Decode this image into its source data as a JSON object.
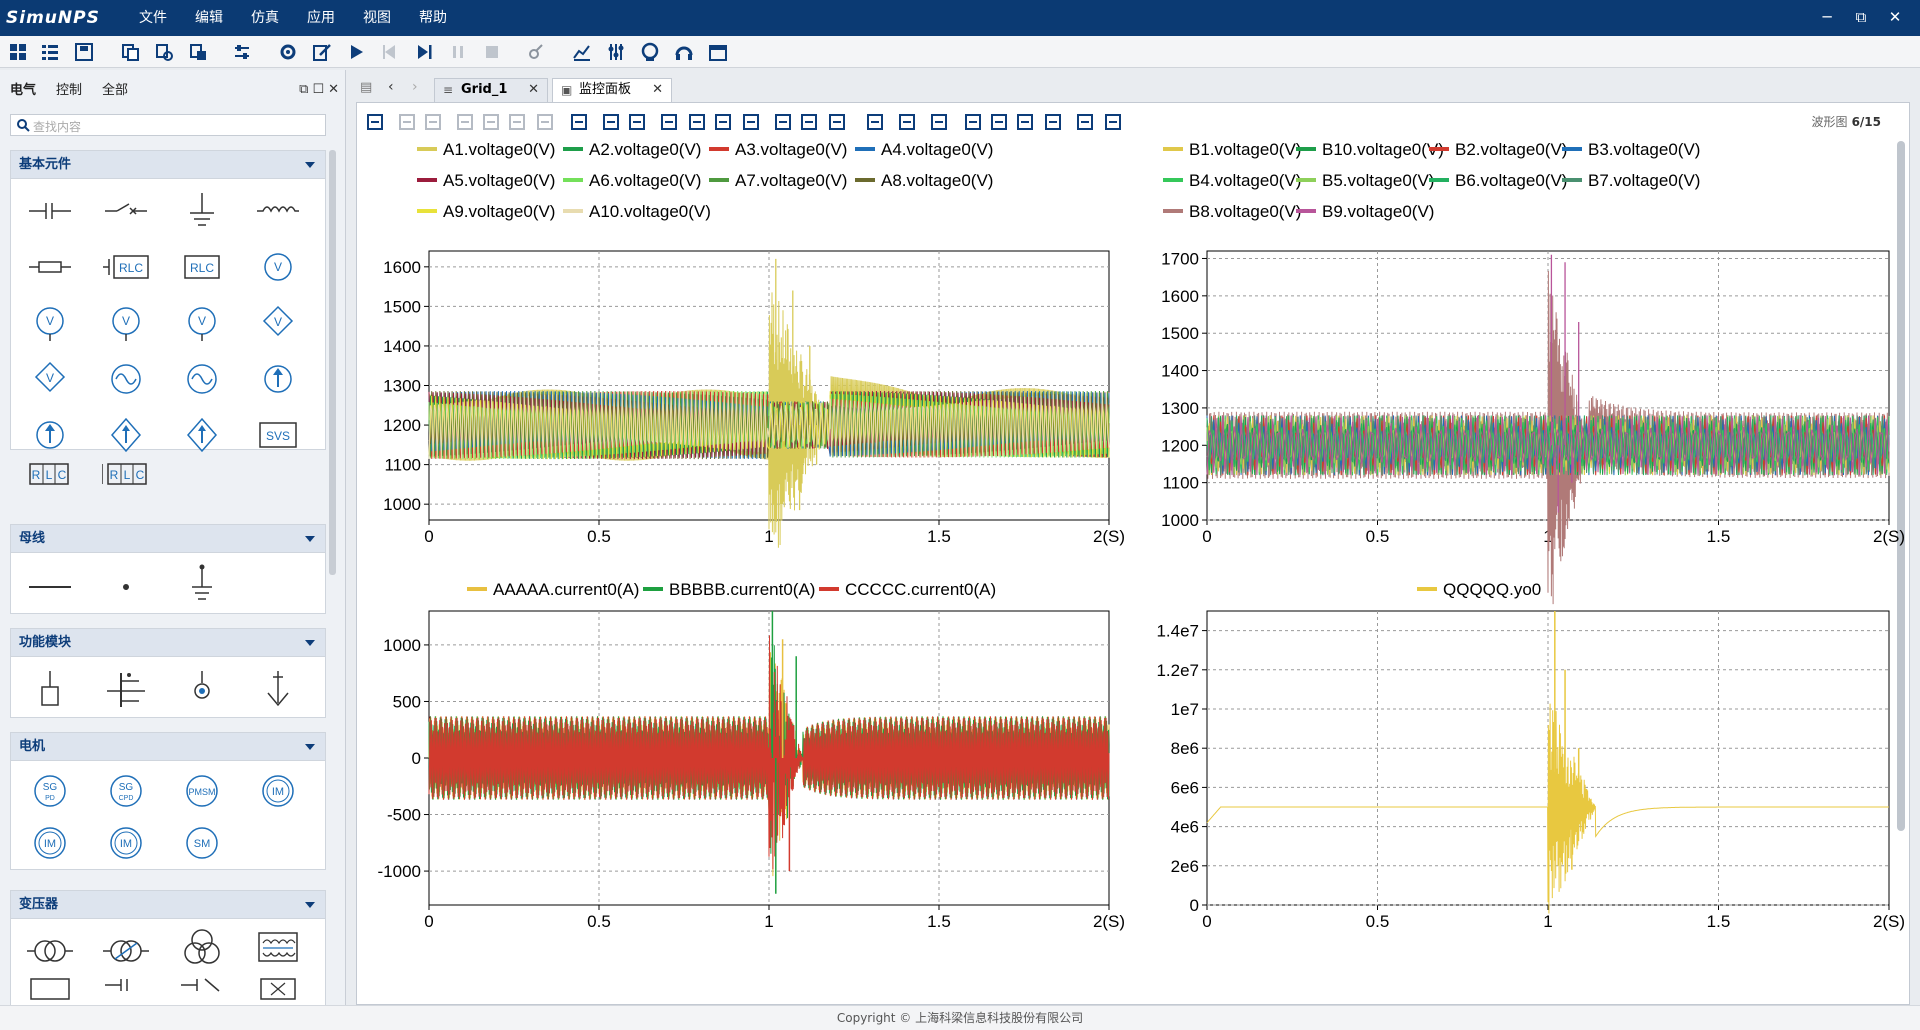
{
  "app": {
    "logo": "SimuNPS",
    "menu": [
      "文件",
      "编辑",
      "仿真",
      "应用",
      "视图",
      "帮助"
    ],
    "window_controls": [
      "─",
      "⧉",
      "✕"
    ]
  },
  "left_panel": {
    "tabs": [
      "电气",
      "控制",
      "全部"
    ],
    "search_placeholder": "查找内容",
    "groups": [
      {
        "title": "基本元件"
      },
      {
        "title": "母线"
      },
      {
        "title": "功能模块"
      },
      {
        "title": "电机"
      },
      {
        "title": "变压器"
      }
    ],
    "symbol_labels": {
      "rlc": "RLC",
      "v": "V",
      "svs": "SVS",
      "r": "R",
      "l": "L",
      "c": "C",
      "sgpd": [
        "SG",
        "PD"
      ],
      "sgcpd": [
        "SG",
        "CPD"
      ],
      "pmsm": "PMSM",
      "im": "IM",
      "sm": "SM"
    }
  },
  "doc_tabs": [
    {
      "label": "Grid_1"
    },
    {
      "label": "监控面板"
    }
  ],
  "wave_counter": {
    "label": "波形图",
    "value": "6/15"
  },
  "status": "Copyright © 上海科梁信息科技股份有限公司",
  "plots": [
    {
      "legend": [
        {
          "name": "A1.voltage0(V)",
          "color": "#d8cb58"
        },
        {
          "name": "A2.voltage0(V)",
          "color": "#1e9e4a"
        },
        {
          "name": "A3.voltage0(V)",
          "color": "#d23a2e"
        },
        {
          "name": "A4.voltage0(V)",
          "color": "#1f6fb8"
        },
        {
          "name": "A5.voltage0(V)",
          "color": "#9b1c3c"
        },
        {
          "name": "A6.voltage0(V)",
          "color": "#74e05a"
        },
        {
          "name": "A7.voltage0(V)",
          "color": "#4f9a3f"
        },
        {
          "name": "A8.voltage0(V)",
          "color": "#6b6a2e"
        },
        {
          "name": "A9.voltage0(V)",
          "color": "#e8e23a"
        },
        {
          "name": "A10.voltage0(V)",
          "color": "#e8dcb0"
        }
      ],
      "x_ticks": [
        "0",
        "0.5",
        "1",
        "1.5",
        "2(S)"
      ],
      "y_ticks": [
        "1600",
        "1500",
        "1400",
        "1300",
        "1200",
        "1100",
        "1000"
      ],
      "ylim": [
        960,
        1640
      ]
    },
    {
      "legend": [
        {
          "name": "B1.voltage0(V)",
          "color": "#e0c84a"
        },
        {
          "name": "B10.voltage0(V)",
          "color": "#1e9e4a"
        },
        {
          "name": "B2.voltage0(V)",
          "color": "#d23a2e"
        },
        {
          "name": "B3.voltage0(V)",
          "color": "#1f6fb8"
        },
        {
          "name": "B4.voltage0(V)",
          "color": "#35c85a"
        },
        {
          "name": "B5.voltage0(V)",
          "color": "#8ed05a"
        },
        {
          "name": "B6.voltage0(V)",
          "color": "#23b060"
        },
        {
          "name": "B7.voltage0(V)",
          "color": "#4a9070"
        },
        {
          "name": "B8.voltage0(V)",
          "color": "#b07a78"
        },
        {
          "name": "B9.voltage0(V)",
          "color": "#b8559a"
        }
      ],
      "x_ticks": [
        "0",
        "0.5",
        "1",
        "1.5",
        "2(S)"
      ],
      "y_ticks": [
        "1700",
        "1600",
        "1500",
        "1400",
        "1300",
        "1200",
        "1100",
        "1000"
      ],
      "ylim": [
        1000,
        1720
      ]
    },
    {
      "legend": [
        {
          "name": "AAAAA.current0(A)",
          "color": "#e8c040"
        },
        {
          "name": "BBBBB.current0(A)",
          "color": "#1ea040"
        },
        {
          "name": "CCCCC.current0(A)",
          "color": "#d23a2e"
        }
      ],
      "x_ticks": [
        "0",
        "0.5",
        "1",
        "1.5",
        "2(S)"
      ],
      "y_ticks": [
        "1000",
        "500",
        "0",
        "-500",
        "-1000"
      ],
      "ylim": [
        -1300,
        1300
      ]
    },
    {
      "legend": [
        {
          "name": "QQQQQ.yo0",
          "color": "#e8c840"
        }
      ],
      "x_ticks": [
        "0",
        "0.5",
        "1",
        "1.5",
        "2(S)"
      ],
      "y_ticks": [
        "1.4e7",
        "1.2e7",
        "1e7",
        "8e6",
        "6e6",
        "4e6",
        "2e6",
        "0"
      ],
      "ylim": [
        0,
        15000000
      ]
    }
  ],
  "chart_data": [
    {
      "type": "line",
      "xlabel": "",
      "ylabel": "",
      "xlim": [
        0,
        2
      ],
      "ylim": [
        960,
        1640
      ],
      "note_series": "A1-A10 voltage, steady oscillation 1110-1290, disturbance at t=1.0-1.15s peaking ~1620 / ~980"
    },
    {
      "type": "line",
      "xlabel": "",
      "ylabel": "",
      "xlim": [
        0,
        2
      ],
      "ylim": [
        1000,
        1720
      ],
      "note_series": "B1-B10 voltage, steady 1110-1290, disturbance at t=1.0-1.12s peaking ~1710 / ~1020"
    },
    {
      "type": "line",
      "xlabel": "",
      "ylabel": "",
      "xlim": [
        0,
        2
      ],
      "ylim": [
        -1300,
        1300
      ],
      "note_series": "three-phase current, steady ±370, disturbance at t=1.0-1.1s peaking ~1300 / ~-1200"
    },
    {
      "type": "line",
      "xlabel": "",
      "ylabel": "",
      "xlim": [
        0,
        2
      ],
      "ylim": [
        0,
        15000000
      ],
      "note_series": "QQQQQ.yo0 steady ~5e6, spike at t=1.02s ~1.5e7, dips ~1.8e6"
    }
  ]
}
